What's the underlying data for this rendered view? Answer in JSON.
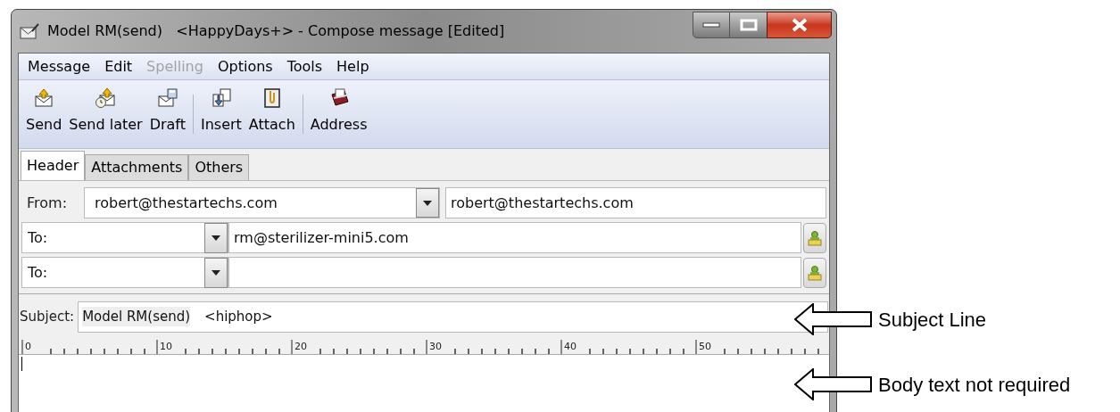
{
  "window": {
    "title": "Model RM(send)   <HappyDays+> - Compose message [Edited]"
  },
  "menu": [
    {
      "label": "Message",
      "disabled": false
    },
    {
      "label": "Edit",
      "disabled": false
    },
    {
      "label": "Spelling",
      "disabled": true
    },
    {
      "label": "Options",
      "disabled": false
    },
    {
      "label": "Tools",
      "disabled": false
    },
    {
      "label": "Help",
      "disabled": false
    }
  ],
  "toolbar": [
    {
      "kind": "button",
      "label": "Send"
    },
    {
      "kind": "button",
      "label": "Send later"
    },
    {
      "kind": "button",
      "label": "Draft"
    },
    {
      "kind": "separator"
    },
    {
      "kind": "button",
      "label": "Insert"
    },
    {
      "kind": "button",
      "label": "Attach"
    },
    {
      "kind": "separator"
    },
    {
      "kind": "button",
      "label": "Address"
    }
  ],
  "tabs": [
    {
      "label": "Header",
      "selected": true
    },
    {
      "label": "Attachments",
      "selected": false
    },
    {
      "label": "Others",
      "selected": false
    }
  ],
  "from": {
    "label": "From:",
    "value": "robert@thestartechs.com",
    "identity": "robert@thestartechs.com"
  },
  "recipients": [
    {
      "type": "To:",
      "address": "rm@sterilizer-mini5.com"
    },
    {
      "type": "To:"
    }
  ],
  "subject": {
    "label": "Subject:",
    "value": "Model RM(send)",
    "extra": "<hiphop>"
  },
  "ruler": [
    "0",
    "10",
    "20",
    "30",
    "40",
    "50"
  ],
  "annotations": [
    "Subject Line",
    "Body text not required"
  ]
}
